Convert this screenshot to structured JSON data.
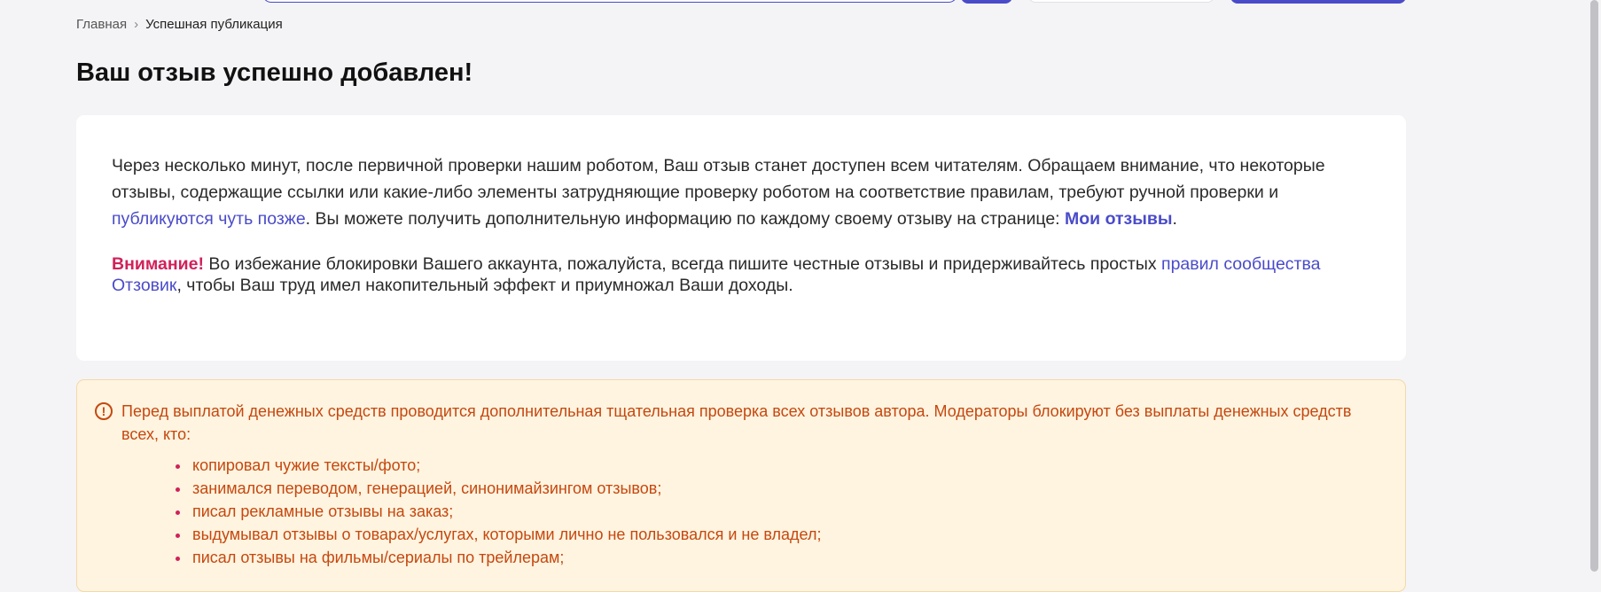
{
  "breadcrumb": {
    "home": "Главная",
    "separator": "›",
    "current": "Успешная публикация"
  },
  "page_title": "Ваш отзыв успешно добавлен!",
  "card": {
    "para1_text_a": "Через несколько минут, после первичной проверки нашим роботом, Ваш отзыв станет доступен всем читателям. Обращаем внимание, что некоторые отзывы, содержащие ссылки или какие-либо элементы затрудняющие проверку роботом на соответствие правилам, требуют ручной проверки и ",
    "para1_link": "публикуются чуть позже",
    "para1_text_b": ". Вы можете получить дополнительную информацию по каждому своему отзыву на странице: ",
    "para1_my_reviews": "Мои отзывы",
    "para1_end": ".",
    "notice_label": "Внимание!",
    "notice_text_a": " Во избежание блокировки Вашего аккаунта, пожалуйста, всегда пишите честные отзывы и придерживайтесь простых ",
    "notice_link": "правил сообщества Отзовик",
    "notice_text_b": ", чтобы Ваш труд имел накопительный эффект и приумножал Ваши доходы."
  },
  "alert": {
    "icon": "exclamation-circle-icon",
    "text": "Перед выплатой денежных средств проводится дополнительная тщательная проверка всех отзывов автора. Модераторы блокируют без выплаты денежных средств всех, кто:",
    "items": [
      "копировал чужие тексты/фото;",
      "занимался переводом, генерацией, синонимайзингом отзывов;",
      "писал рекламные отзывы на заказ;",
      "выдумывал отзывы о товарах/услугах, которыми лично не пользовался и не владел;",
      "писал отзывы на фильмы/сериалы по трейлерам;"
    ]
  },
  "colors": {
    "accent": "#4a4bc9",
    "warning_red": "#d0215a",
    "alert_text": "#c5480f",
    "alert_bg": "#fff4e0"
  }
}
